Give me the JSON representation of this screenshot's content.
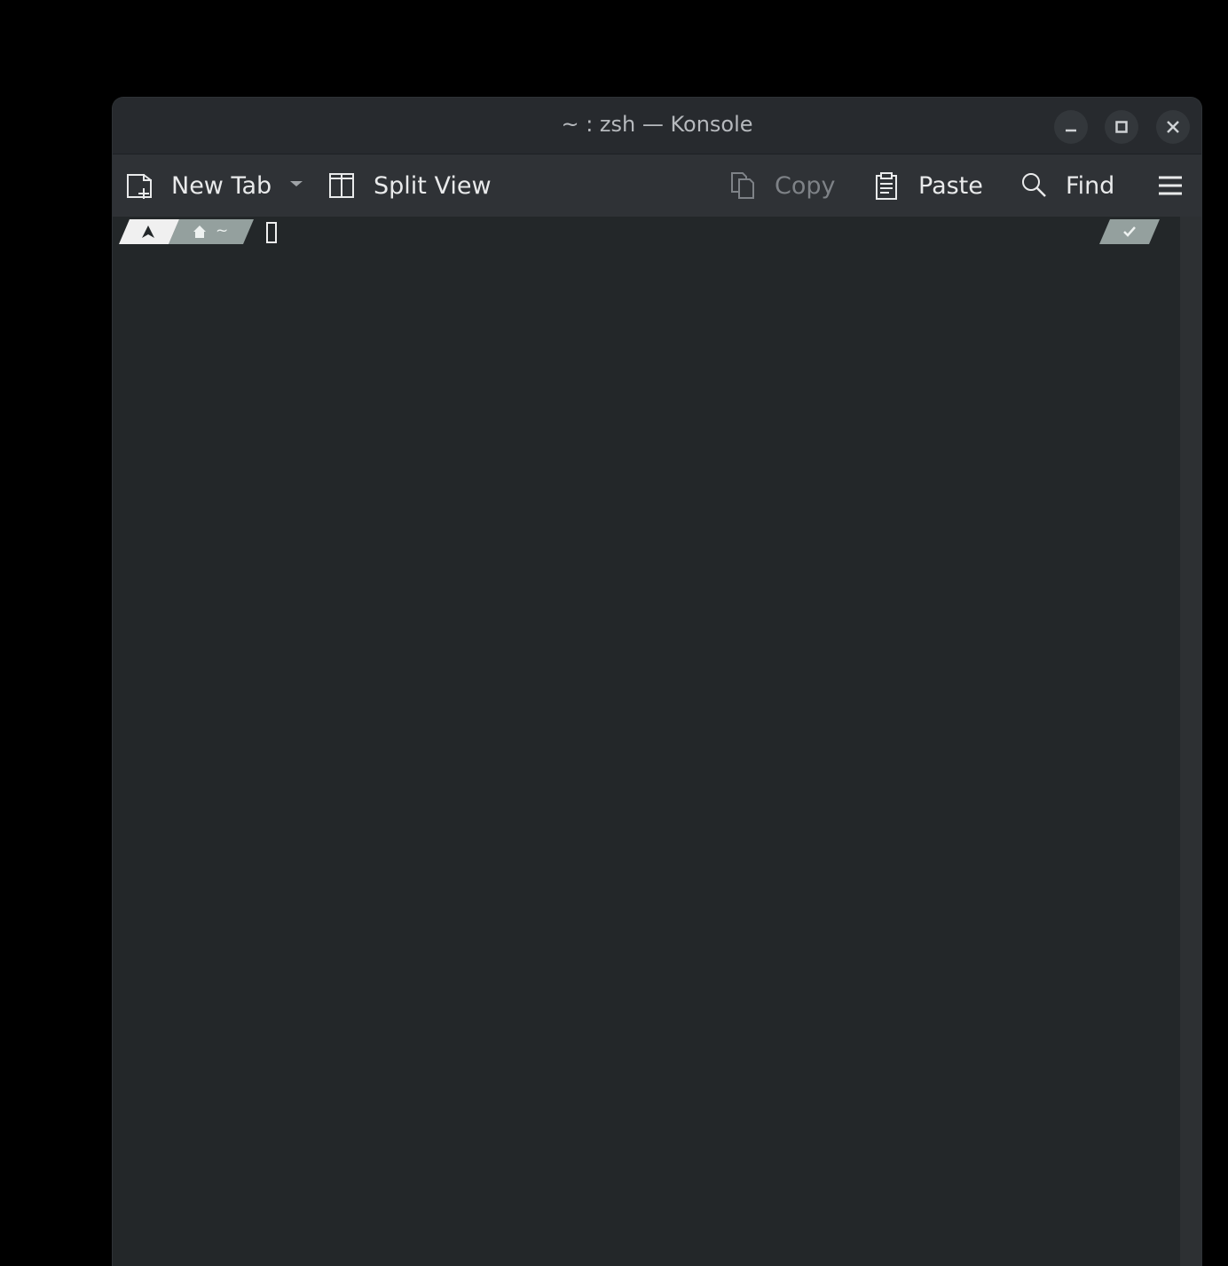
{
  "window": {
    "title": "~ : zsh — Konsole",
    "controls": [
      {
        "name": "minimize",
        "icon": "minimize-icon"
      },
      {
        "name": "maximize",
        "icon": "maximize-icon"
      },
      {
        "name": "close",
        "icon": "close-icon"
      }
    ]
  },
  "toolbar": {
    "new_tab": {
      "label": "New Tab",
      "icon": "new-tab-icon",
      "menu_icon": "chevron-down-icon"
    },
    "split_view": {
      "label": "Split View",
      "icon": "split-view-icon"
    },
    "copy": {
      "label": "Copy",
      "icon": "copy-icon",
      "enabled": false
    },
    "paste": {
      "label": "Paste",
      "icon": "paste-icon"
    },
    "find": {
      "label": "Find",
      "icon": "search-icon"
    },
    "menu": {
      "icon": "hamburger-menu-icon"
    }
  },
  "prompt": {
    "os_icon": "arch-logo-icon",
    "home_icon": "home-icon",
    "path": "~",
    "status_icon": "check-icon"
  },
  "colors": {
    "background": "#232729",
    "toolbar": "#2f3236",
    "titlebar": "#272a2e",
    "prompt_os_segment": "#f0f0f0",
    "prompt_path_segment": "#94a09e"
  }
}
